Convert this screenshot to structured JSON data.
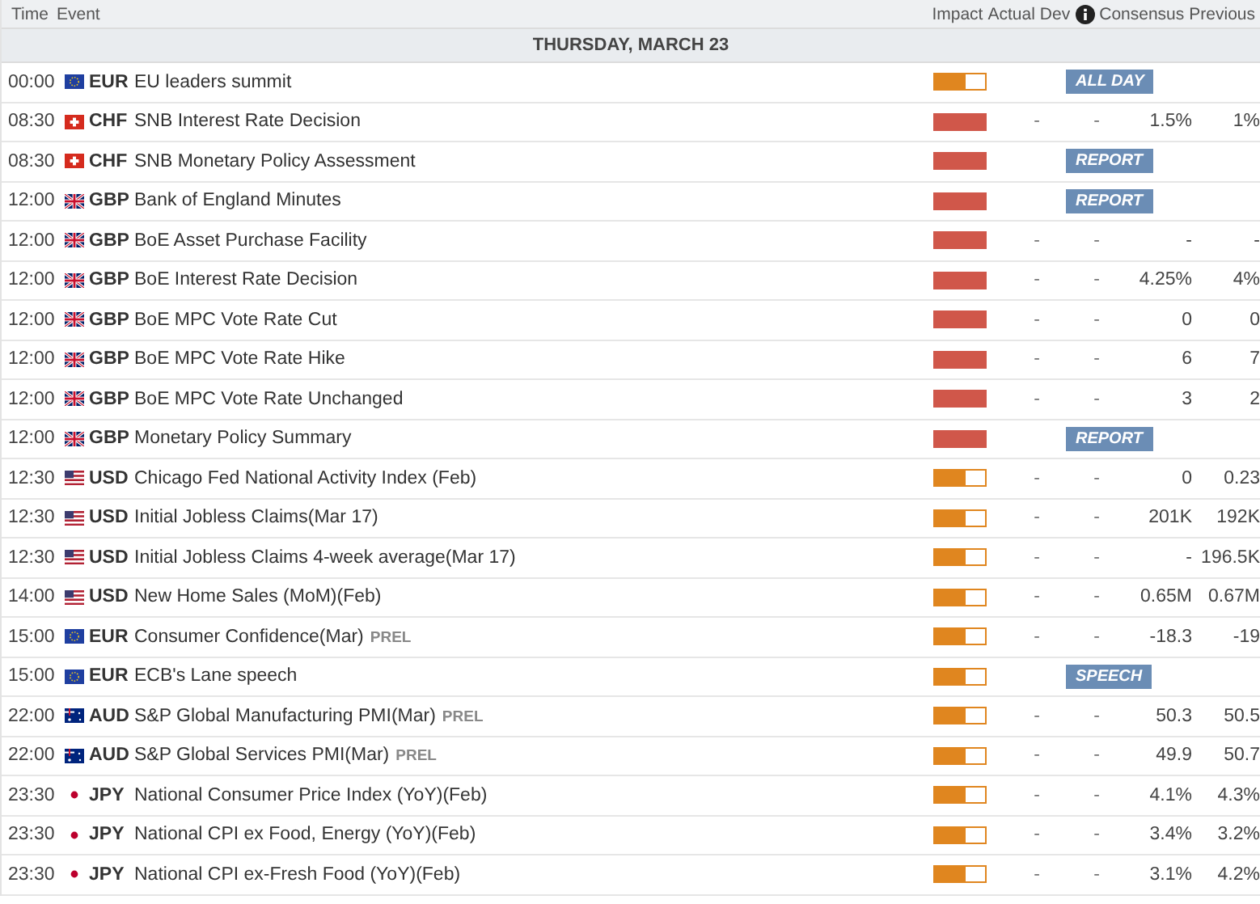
{
  "columns": {
    "time": "Time",
    "event": "Event",
    "impact": "Impact",
    "actual": "Actual",
    "dev": "Dev",
    "consensus": "Consensus",
    "previous": "Previous"
  },
  "date": "THURSDAY, MARCH 23",
  "rows": [
    {
      "time": "00:00",
      "kind": "eu",
      "currency": "EUR",
      "event": "EU leaders summit",
      "level": 0.6,
      "color": "#e0861f",
      "badge": "ALL DAY"
    },
    {
      "time": "08:30",
      "kind": "ch",
      "currency": "CHF",
      "event": "SNB Interest Rate Decision",
      "level": 1,
      "color": "#d0574a",
      "actual": "-",
      "dev": "-",
      "consensus": "1.5%",
      "previous": "1%"
    },
    {
      "time": "08:30",
      "kind": "ch",
      "currency": "CHF",
      "event": "SNB Monetary Policy Assessment",
      "level": 1,
      "color": "#d0574a",
      "badge": "REPORT"
    },
    {
      "time": "12:00",
      "kind": "gb",
      "currency": "GBP",
      "event": "Bank of England Minutes",
      "level": 1,
      "color": "#d0574a",
      "badge": "REPORT"
    },
    {
      "time": "12:00",
      "kind": "gb",
      "currency": "GBP",
      "event": "BoE Asset Purchase Facility",
      "level": 1,
      "color": "#d0574a",
      "actual": "-",
      "dev": "-",
      "consensus": "-",
      "previous": "-"
    },
    {
      "time": "12:00",
      "kind": "gb",
      "currency": "GBP",
      "event": "BoE Interest Rate Decision",
      "level": 1,
      "color": "#d0574a",
      "actual": "-",
      "dev": "-",
      "consensus": "4.25%",
      "previous": "4%"
    },
    {
      "time": "12:00",
      "kind": "gb",
      "currency": "GBP",
      "event": "BoE MPC Vote Rate Cut",
      "level": 1,
      "color": "#d0574a",
      "actual": "-",
      "dev": "-",
      "consensus": "0",
      "previous": "0"
    },
    {
      "time": "12:00",
      "kind": "gb",
      "currency": "GBP",
      "event": "BoE MPC Vote Rate Hike",
      "level": 1,
      "color": "#d0574a",
      "actual": "-",
      "dev": "-",
      "consensus": "6",
      "previous": "7"
    },
    {
      "time": "12:00",
      "kind": "gb",
      "currency": "GBP",
      "event": "BoE MPC Vote Rate Unchanged",
      "level": 1,
      "color": "#d0574a",
      "actual": "-",
      "dev": "-",
      "consensus": "3",
      "previous": "2"
    },
    {
      "time": "12:00",
      "kind": "gb",
      "currency": "GBP",
      "event": "Monetary Policy Summary",
      "level": 1,
      "color": "#d0574a",
      "badge": "REPORT"
    },
    {
      "time": "12:30",
      "kind": "us",
      "currency": "USD",
      "event": "Chicago Fed National Activity Index (Feb)",
      "level": 0.6,
      "color": "#e0861f",
      "actual": "-",
      "dev": "-",
      "consensus": "0",
      "previous": "0.23"
    },
    {
      "time": "12:30",
      "kind": "us",
      "currency": "USD",
      "event": "Initial Jobless Claims(Mar 17)",
      "level": 0.6,
      "color": "#e0861f",
      "actual": "-",
      "dev": "-",
      "consensus": "201K",
      "previous": "192K"
    },
    {
      "time": "12:30",
      "kind": "us",
      "currency": "USD",
      "event": "Initial Jobless Claims 4-week average(Mar 17)",
      "level": 0.6,
      "color": "#e0861f",
      "actual": "-",
      "dev": "-",
      "consensus": "-",
      "previous": "196.5K"
    },
    {
      "time": "14:00",
      "kind": "us",
      "currency": "USD",
      "event": "New Home Sales (MoM)(Feb)",
      "level": 0.6,
      "color": "#e0861f",
      "actual": "-",
      "dev": "-",
      "consensus": "0.65M",
      "previous": "0.67M"
    },
    {
      "time": "15:00",
      "kind": "eu",
      "currency": "EUR",
      "event": "Consumer Confidence(Mar)",
      "suffix": "PREL",
      "level": 0.6,
      "color": "#e0861f",
      "actual": "-",
      "dev": "-",
      "consensus": "-18.3",
      "previous": "-19"
    },
    {
      "time": "15:00",
      "kind": "eu",
      "currency": "EUR",
      "event": "ECB's Lane speech",
      "level": 0.6,
      "color": "#e0861f",
      "badge": "SPEECH"
    },
    {
      "time": "22:00",
      "kind": "au",
      "currency": "AUD",
      "event": "S&P Global Manufacturing PMI(Mar)",
      "suffix": "PREL",
      "level": 0.6,
      "color": "#e0861f",
      "actual": "-",
      "dev": "-",
      "consensus": "50.3",
      "previous": "50.5"
    },
    {
      "time": "22:00",
      "kind": "au",
      "currency": "AUD",
      "event": "S&P Global Services PMI(Mar)",
      "suffix": "PREL",
      "level": 0.6,
      "color": "#e0861f",
      "actual": "-",
      "dev": "-",
      "consensus": "49.9",
      "previous": "50.7"
    },
    {
      "time": "23:30",
      "kind": "jp",
      "currency": "JPY",
      "event": "National Consumer Price Index (YoY)(Feb)",
      "level": 0.6,
      "color": "#e0861f",
      "actual": "-",
      "dev": "-",
      "consensus": "4.1%",
      "previous": "4.3%"
    },
    {
      "time": "23:30",
      "kind": "jp",
      "currency": "JPY",
      "event": "National CPI ex Food, Energy (YoY)(Feb)",
      "level": 0.6,
      "color": "#e0861f",
      "actual": "-",
      "dev": "-",
      "consensus": "3.4%",
      "previous": "3.2%"
    },
    {
      "time": "23:30",
      "kind": "jp",
      "currency": "JPY",
      "event": "National CPI ex-Fresh Food (YoY)(Feb)",
      "level": 0.6,
      "color": "#e0861f",
      "actual": "-",
      "dev": "-",
      "consensus": "3.1%",
      "previous": "4.2%"
    }
  ]
}
